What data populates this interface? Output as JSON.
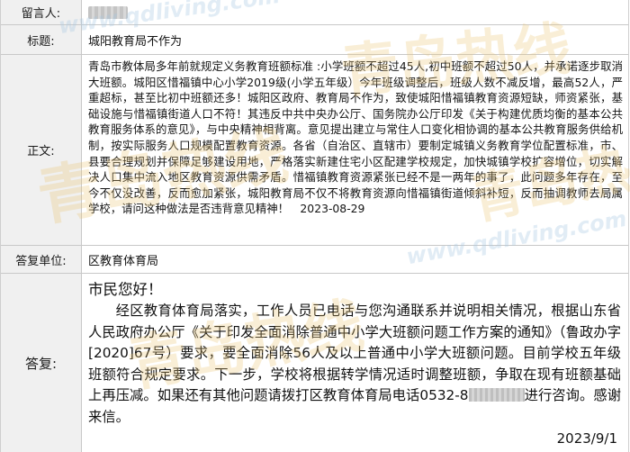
{
  "fields": {
    "author_label": "留言人:",
    "title_label": "标题:",
    "title_value": "城阳教育局不作为",
    "body_label": "正文:",
    "body_value": "青岛市教体局多年前就规定义务教育班额标准 :小学班额不超过45人,初中班额不超过50人，并承诺逐步取消大班额。城阳区惜福镇中心小学2019级(小学五年级）今年班级调整后，班级人数不减反增，最高52人，严重超标，甚至比初中班额还多！城阳区政府、教育局不作为，致使城阳惜福镇教育资源短缺，师资紧张，基础设施与惜福镇街道人口不符！其违反中共中央办公厅、国务院办公厅印发《关于构建优质均衡的基本公共教育服务体系的意见》，与中央精神相背离。意见提出建立与常住人口变化相协调的基本公共教育服务供给机制，按实际服务人口规模配置教育资源。各省（自治区、直辖市）要制定城镇义务教育学位配置标准，市、县要合理规划并保障足够建设用地，严格落实新建住宅小区配建学校规定，加快城镇学校扩容增位，切实解决人口集中流入地区教育资源供需矛盾。惜福镇教育资源紧张已经不是一两年的事了，此问题多年存在，至今不仅没改善，反而愈加紧张，城阳教育局不仅不将教育资源向惜福镇街道倾斜补短，反而抽调教师去局属学校，请问这种做法是否违背意见精神！　2023-08-29",
    "unit_label": "答复单位:",
    "unit_value": "区教育体育局",
    "reply_label": "答复:",
    "reply_greeting": "市民您好！",
    "reply_main": "经区教育体育局落实，工作人员已电话与您沟通联系并说明相关情况，根据山东省人民政府办公厅《关于印发全面消除普通中小学大班额问题工作方案的通知》（鲁政办字 [2020]67号）要求，要全面消除56人及以上普通中小学大班额问题。目前学校五年级班额符合规定要求。下一步，学校将根据转学情况适时调整班额，争取在现有班额基础上再压减。如果还有其他问题请拨打区教育体育局电话0532-8",
    "reply_tail": "进行咨询。感谢来信。",
    "reply_date": "2023/9/1"
  },
  "watermark": {
    "cn_text": "青岛热线",
    "url_text": "www.qdliving.com"
  },
  "colors": {
    "label_bg": "#f0f0f0",
    "border": "#c8c8c8",
    "watermark": "#ebc878"
  }
}
